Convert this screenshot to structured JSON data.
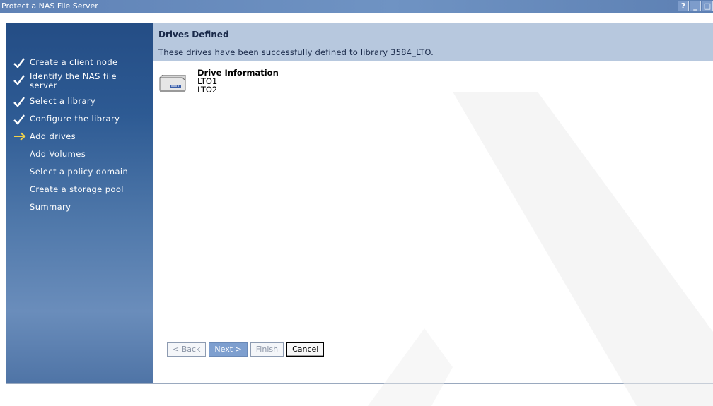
{
  "window": {
    "title": "Protect a NAS File Server",
    "controls": [
      "?",
      "_",
      "□"
    ]
  },
  "steps": [
    {
      "label": "Create a client node",
      "state": "done"
    },
    {
      "label": "Identify the NAS file server",
      "line1": "Identify the NAS file",
      "line2": "server",
      "state": "done"
    },
    {
      "label": "Select a library",
      "state": "done"
    },
    {
      "label": "Configure the library",
      "state": "done"
    },
    {
      "label": "Add drives",
      "state": "current"
    },
    {
      "label": "Add Volumes",
      "state": "pending"
    },
    {
      "label": "Select a policy domain",
      "state": "pending"
    },
    {
      "label": "Create a storage pool",
      "state": "pending"
    },
    {
      "label": "Summary",
      "state": "pending"
    }
  ],
  "content": {
    "heading": "Drives Defined",
    "description": "These drives have been successfully defined to library 3584_LTO.",
    "drive_info_label": "Drive Information",
    "drives": [
      "LTO1",
      "LTO2"
    ]
  },
  "buttons": {
    "back": "< Back",
    "next": "Next >",
    "finish": "Finish",
    "cancel": "Cancel"
  },
  "icons": {
    "done": "checkmark-icon",
    "current": "arrow-right-icon",
    "drive": "tape-drive-icon"
  },
  "colors": {
    "titlebar": "#6f93c3",
    "sidebar_top": "#244d85",
    "header_bg": "#b7c8de",
    "current_arrow": "#f2d24a"
  }
}
